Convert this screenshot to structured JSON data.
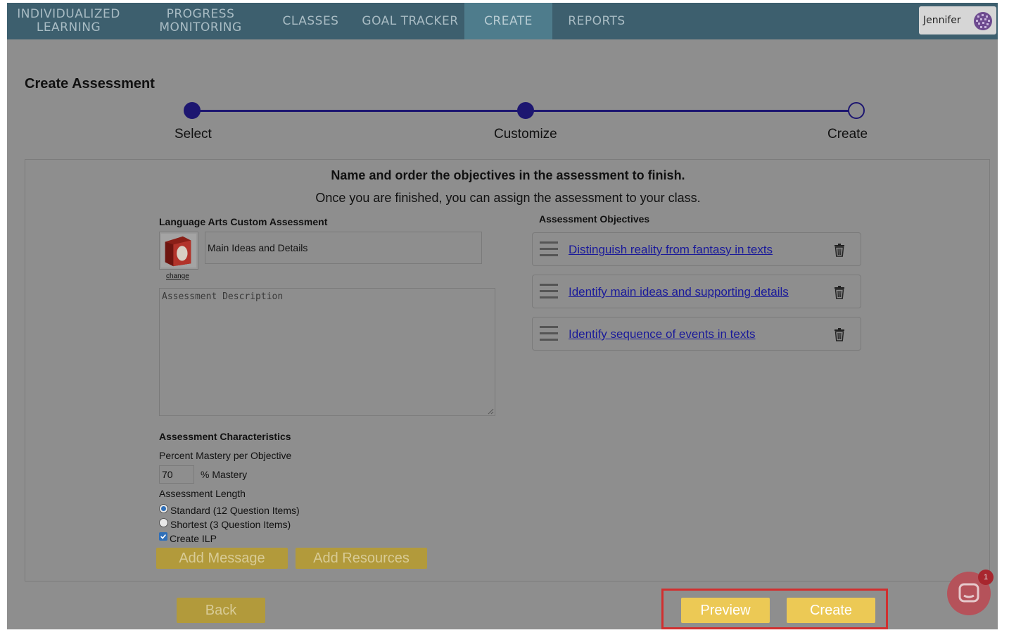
{
  "nav": {
    "items": [
      {
        "label_line1": "INDIVIDUALIZED",
        "label_line2": "LEARNING"
      },
      {
        "label_line1": "PROGRESS",
        "label_line2": "MONITORING"
      },
      {
        "label": "CLASSES"
      },
      {
        "label": "GOAL TRACKER"
      },
      {
        "label": "CREATE",
        "active": true
      },
      {
        "label": "REPORTS"
      }
    ],
    "user_name": "Jennifer",
    "user_icon": "avatar-grid-icon"
  },
  "page_title": "Create Assessment",
  "stepper": {
    "steps": [
      {
        "label": "Select",
        "state": "complete"
      },
      {
        "label": "Customize",
        "state": "complete"
      },
      {
        "label": "Create",
        "state": "current"
      }
    ]
  },
  "panel": {
    "heading": "Name and order the objectives in the assessment to finish.",
    "subheading": "Once you are finished, you can assign the assessment to your class.",
    "assessment_type_label": "Language Arts Custom Assessment",
    "book_icon": "red-book-icon",
    "change_link": "change",
    "name_value": "Main Ideas and Details",
    "description_placeholder": "Assessment Description",
    "characteristics_label": "Assessment Characteristics",
    "mastery_label": "Percent Mastery per Objective",
    "mastery_value": "70",
    "mastery_suffix": "% Mastery",
    "length_label": "Assessment Length",
    "length_options": [
      {
        "label": "Standard (12 Question Items)",
        "selected": true
      },
      {
        "label": "Shortest (3 Question Items)",
        "selected": false
      }
    ],
    "create_ilp_label": "Create ILP",
    "create_ilp_checked": true,
    "add_message_label": "Add Message",
    "add_resources_label": "Add Resources",
    "objectives_label": "Assessment Objectives",
    "objectives": [
      {
        "text": "Distinguish reality from fantasy in texts"
      },
      {
        "text": "Identify main ideas and supporting details"
      },
      {
        "text": "Identify sequence of events in texts"
      }
    ]
  },
  "footer": {
    "back_label": "Back",
    "preview_label": "Preview",
    "create_label": "Create"
  },
  "chat": {
    "badge_count": "1"
  },
  "colors": {
    "nav_bg": "#3d5f6e",
    "nav_active": "#4e7c8c",
    "overlay_bg": "#8e8e8e",
    "stepper": "#1d1670",
    "gold_dim": "#b29a3b",
    "gold_bright": "#ecc955",
    "highlight": "#d12f2f",
    "chat": "#b5525a"
  }
}
